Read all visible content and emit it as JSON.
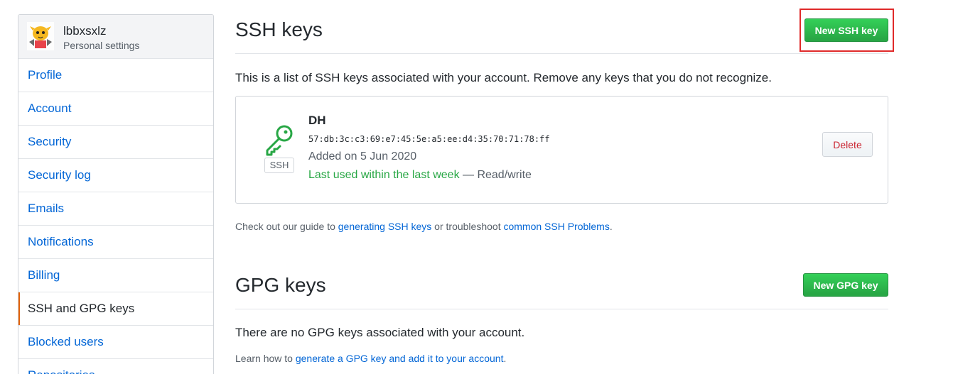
{
  "sidebar": {
    "user_name": "lbbxsxlz",
    "user_subtitle": "Personal settings",
    "items": [
      {
        "label": "Profile",
        "selected": false
      },
      {
        "label": "Account",
        "selected": false
      },
      {
        "label": "Security",
        "selected": false
      },
      {
        "label": "Security log",
        "selected": false
      },
      {
        "label": "Emails",
        "selected": false
      },
      {
        "label": "Notifications",
        "selected": false
      },
      {
        "label": "Billing",
        "selected": false
      },
      {
        "label": "SSH and GPG keys",
        "selected": true
      },
      {
        "label": "Blocked users",
        "selected": false
      },
      {
        "label": "Repositories",
        "selected": false
      }
    ]
  },
  "ssh": {
    "title": "SSH keys",
    "new_button": "New SSH key",
    "intro": "This is a list of SSH keys associated with your account. Remove any keys that you do not recognize.",
    "keys": [
      {
        "name": "DH",
        "fingerprint": "57:db:3c:c3:69:e7:45:5e:a5:ee:d4:35:70:71:78:ff",
        "added": "Added on 5 Jun 2020",
        "last_used": "Last used within the last week",
        "access": " — Read/write",
        "badge": "SSH",
        "delete_label": "Delete"
      }
    ],
    "guide": {
      "prefix": "Check out our guide to ",
      "link1": "generating SSH keys",
      "middle": " or troubleshoot ",
      "link2": "common SSH Problems",
      "suffix": "."
    }
  },
  "gpg": {
    "title": "GPG keys",
    "new_button": "New GPG key",
    "empty": "There are no GPG keys associated with your account.",
    "learn_prefix": "Learn how to ",
    "learn_link": "generate a GPG key and add it to your account",
    "learn_suffix": "."
  },
  "colors": {
    "primary_green": "#28a745",
    "link_blue": "#0366d6",
    "danger_red": "#cb2431",
    "highlight_red": "#e02a2a",
    "selected_accent": "#e36209"
  }
}
